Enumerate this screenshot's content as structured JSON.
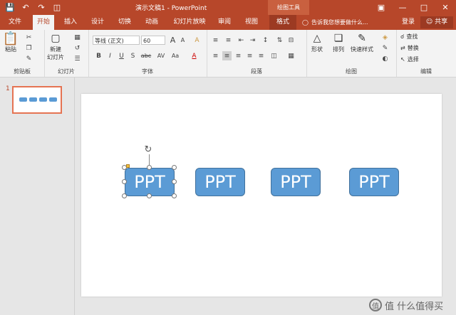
{
  "window": {
    "title": "演示文稿1 - PowerPoint",
    "context_tab_title": "绘图工具",
    "qat": [
      "save-icon",
      "undo-icon",
      "redo-icon",
      "slideshow-icon"
    ],
    "controls": [
      "ribbon-display-icon",
      "minimize-icon",
      "maximize-icon",
      "close-icon"
    ]
  },
  "tabs": [
    {
      "label": "文件",
      "active": false
    },
    {
      "label": "开始",
      "active": true
    },
    {
      "label": "插入",
      "active": false
    },
    {
      "label": "设计",
      "active": false
    },
    {
      "label": "切换",
      "active": false
    },
    {
      "label": "动画",
      "active": false
    },
    {
      "label": "幻灯片放映",
      "active": false
    },
    {
      "label": "审阅",
      "active": false
    },
    {
      "label": "视图",
      "active": false
    },
    {
      "label": "格式",
      "active": false
    }
  ],
  "tell_me": "告诉我您想要做什么...",
  "login": "登录",
  "share": "共享",
  "ribbon": {
    "clipboard": {
      "label": "剪贴板",
      "paste": "粘贴"
    },
    "slides": {
      "label": "幻灯片",
      "new_slide": "新建",
      "new_slide_2": "幻灯片"
    },
    "font": {
      "label": "字体",
      "font_name": "等线 (正文)",
      "font_size": "60",
      "bold": "B",
      "italic": "I",
      "underline": "U",
      "shadow": "S",
      "strike": "abc",
      "spacing": "AV",
      "case": "Aa",
      "grow": "A",
      "shrink": "A",
      "clear": "A",
      "color": "A"
    },
    "paragraph": {
      "label": "段落"
    },
    "drawing": {
      "label": "绘图",
      "shapes": "形状",
      "arrange": "排列",
      "quick_styles": "快速样式"
    },
    "editing": {
      "label": "编辑",
      "find": "查找",
      "replace": "替换",
      "select": "选择"
    }
  },
  "thumbnail": {
    "number": "1"
  },
  "slide": {
    "shapes": [
      {
        "text": "PPT",
        "selected": true
      },
      {
        "text": "PPT",
        "selected": false
      },
      {
        "text": "PPT",
        "selected": false
      },
      {
        "text": "PPT",
        "selected": false
      }
    ]
  },
  "watermark": "值 什么值得买",
  "colors": {
    "accent": "#b7472a",
    "shape_fill": "#5b9bd5",
    "shape_border": "#41719c"
  }
}
